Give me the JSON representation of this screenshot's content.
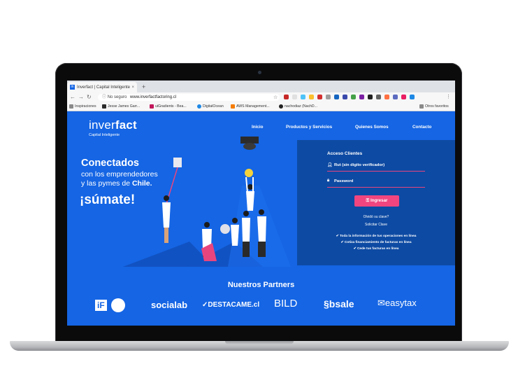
{
  "browser": {
    "tab_title": "Inverfact | Capital Inteligente",
    "tab_favicon": "in",
    "new_tab_label": "+",
    "security_label": "No seguro",
    "url": "www.inverfactfactoring.cl",
    "bookmarks": [
      {
        "label": "Inspiraciones",
        "color": "#8a8a8a"
      },
      {
        "label": "Jesse James Garr...",
        "color": "#2b2b2b"
      },
      {
        "label": "uiGradients - Bea...",
        "color": "#c2185b"
      },
      {
        "label": "DigitalOcean",
        "color": "#1e88e5"
      },
      {
        "label": "AWS Management...",
        "color": "#f57c00"
      },
      {
        "label": "nachodiaz (NachD...",
        "color": "#222222"
      }
    ],
    "other_bookmarks": "Otros favoritos",
    "extension_colors": [
      "#c62828",
      "#e0e0e0",
      "#4fc3f7",
      "#fbc02d",
      "#d32f2f",
      "#9e9e9e",
      "#1565c0",
      "#3949ab",
      "#43a047",
      "#7b1fa2",
      "#212121",
      "#616161",
      "#ff7043",
      "#5c6bc0",
      "#e91e63",
      "#1e88e5"
    ]
  },
  "site": {
    "logo_light": "inver",
    "logo_bold": "fact",
    "tagline": "Capital Inteligente",
    "nav": [
      "Inicio",
      "Productos y Servicios",
      "Quienes Somos",
      "Contacto"
    ],
    "hero": {
      "title": "Conectados",
      "line1": "con los emprendedores",
      "line2_prefix": "y las pymes de ",
      "line2_bold": "Chile.",
      "cta": "¡súmate!"
    },
    "login": {
      "title": "Acceso Clientes",
      "rut_placeholder": "Rut (sin digito verificador)",
      "password_placeholder": "Password",
      "submit": "Ingresar",
      "forgot": "Olvidó su clave?",
      "request": "Solicitar Clave",
      "perks": [
        "Toda la información de tus operaciones en línea",
        "Cotiza financiamiento de facturas en línea",
        "Cede tus facturas en línea"
      ]
    },
    "partners_title": "Nuestros Partners",
    "partners": [
      "iF",
      "socialab",
      "DESTACAME.cl",
      "BILD",
      "bsale",
      "easytax"
    ]
  },
  "colors": {
    "brand_blue": "#1565e4",
    "panel_blue": "#0d4aa3",
    "accent_pink": "#f0457f"
  }
}
